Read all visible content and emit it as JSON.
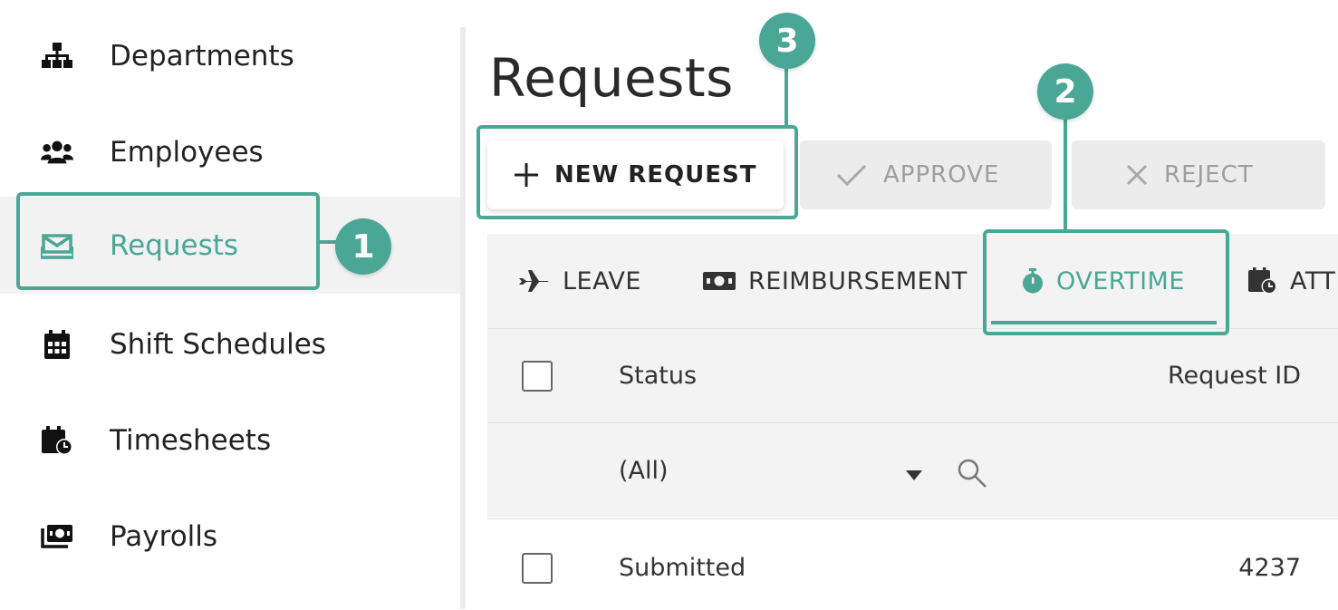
{
  "sidebar": {
    "items": [
      {
        "label": "Departments",
        "icon": "sitemap-icon"
      },
      {
        "label": "Employees",
        "icon": "users-icon"
      },
      {
        "label": "Requests",
        "icon": "envelope-tray-icon",
        "active": true
      },
      {
        "label": "Shift Schedules",
        "icon": "calendar-grid-icon"
      },
      {
        "label": "Timesheets",
        "icon": "calendar-clock-icon"
      },
      {
        "label": "Payrolls",
        "icon": "money-stack-icon"
      }
    ]
  },
  "main": {
    "title": "Requests",
    "toolbar": {
      "new_label": "NEW REQUEST",
      "approve_label": "APPROVE",
      "reject_label": "REJECT"
    },
    "tabs": [
      {
        "label": "LEAVE",
        "icon": "plane-icon"
      },
      {
        "label": "REIMBURSEMENT",
        "icon": "money-icon"
      },
      {
        "label": "OVERTIME",
        "icon": "stopwatch-icon",
        "active": true
      },
      {
        "label": "ATT",
        "icon": "calendar-clock-icon"
      }
    ],
    "grid": {
      "columns": [
        "Status",
        "Request ID"
      ],
      "filter": {
        "status_value": "(All)"
      },
      "rows": [
        {
          "status": "Submitted",
          "request_id": "4237"
        }
      ]
    }
  },
  "callouts": [
    "1",
    "2",
    "3"
  ],
  "colors": {
    "accent": "#4aa795",
    "active_bg": "#f2f2f2",
    "disabled_bg": "#ececec"
  }
}
